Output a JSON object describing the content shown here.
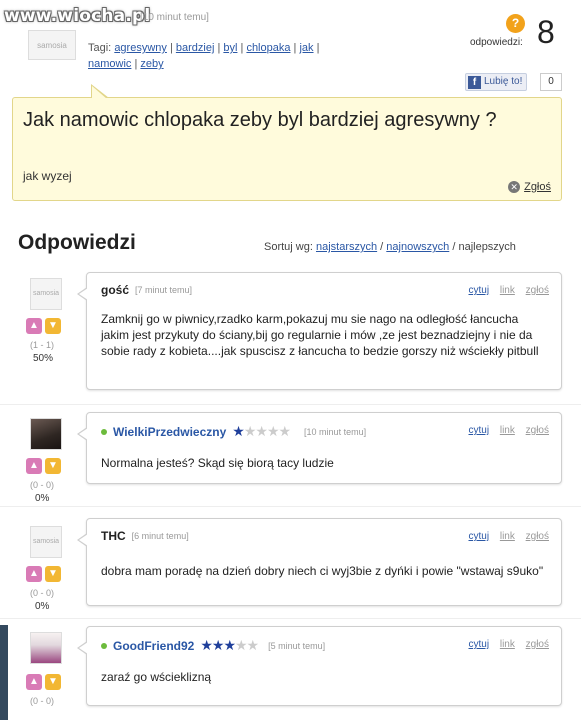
{
  "watermark": "www.wiocha.pl",
  "top": {
    "avatar_label": "samosia",
    "meta": "[10 minut temu]",
    "tags_label": "Tagi:",
    "tags": [
      "agresywny",
      "bardziej",
      "byl",
      "chlopaka",
      "jak",
      "namowic",
      "zeby"
    ],
    "answers_label": "odpowiedzi:",
    "answers_count": "8",
    "like_label": "Lubię to!",
    "like_count": "0"
  },
  "question": {
    "title": "Jak namowic chlopaka zeby byl bardziej agresywny ?",
    "body": "jak wyzej",
    "report": "Zgłoś"
  },
  "answers_section": {
    "heading": "Odpowiedzi",
    "sort_label": "Sortuj wg:",
    "sort_oldest": "najstarszych",
    "sort_newest": "najnowszych",
    "sort_best": "najlepszych"
  },
  "comment_actions": {
    "quote": "cytuj",
    "link": "link",
    "report": "zgłoś"
  },
  "answers": [
    {
      "author": "gość",
      "time": "[7 minut temu]",
      "text": "Zamknij go w piwnicy,rzadko karm,pokazuj mu sie nago na odległość łancucha jakim jest przykuty do ściany,bij go regularnie i mów ,ze jest beznadziejny i nie da sobie rady z kobieta....jak spuscisz z łancucha to bedzie gorszy niż wściekły pitbull",
      "votes": "(1 - 1)",
      "percent": "50%",
      "avatar": "samosia",
      "stars": 0
    },
    {
      "author": "WielkiPrzedwieczny",
      "time": "[10 minut temu]",
      "text": "Normalna jesteś? Skąd się biorą tacy ludzie",
      "votes": "(0 - 0)",
      "percent": "0%",
      "avatar": "",
      "stars": 1
    },
    {
      "author": "THC",
      "time": "[6 minut temu]",
      "text": "dobra mam poradę na dzień dobry niech ci wyj3bie z dyńki i powie \"wstawaj s9uko\"",
      "votes": "(0 - 0)",
      "percent": "0%",
      "avatar": "samosia",
      "stars": 0
    },
    {
      "author": "GoodFriend92",
      "time": "[5 minut temu]",
      "text": "zaraź go wścieklizną",
      "votes": "(0 - 0)",
      "percent": "",
      "avatar": "",
      "stars": 3
    }
  ],
  "colors": {
    "link": "#2a57a5",
    "question_bg": "#fffbdc",
    "star": "#1f3f9b",
    "thumb_up": "#d97bb6",
    "thumb_down": "#f2b733"
  }
}
